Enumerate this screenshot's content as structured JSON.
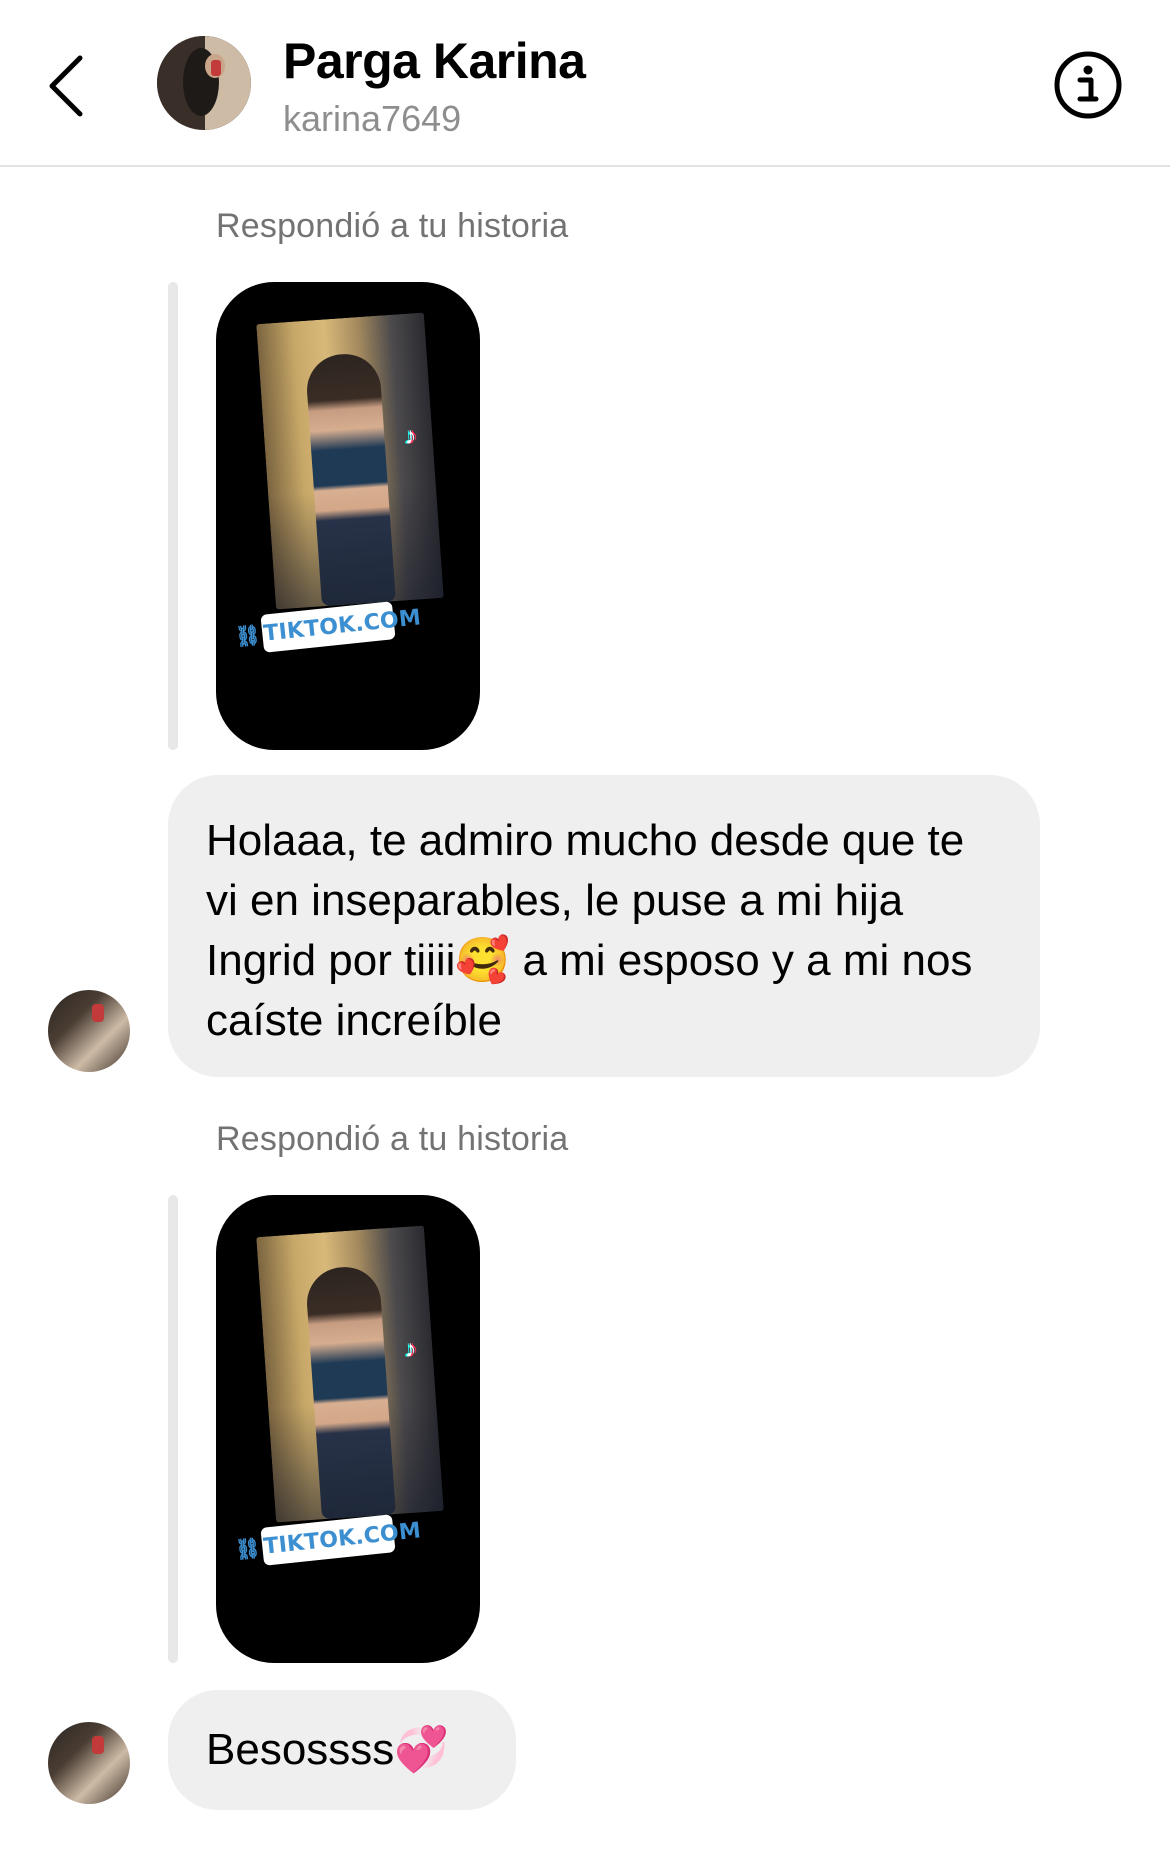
{
  "header": {
    "name": "Parga Karina",
    "username": "karina7649",
    "back_icon": "chevron-left-icon",
    "info_icon": "info-circle-icon"
  },
  "thread": [
    {
      "type": "story_reply",
      "caption": "Respondió a tu historia",
      "story_link_label": "TIKTOK.COM",
      "message": "Holaaa, te admiro mucho desde que te vi en inseparables, le puse a mi hija Ingrid por tiiii🥰 a mi esposo y a mi nos caíste increíble"
    },
    {
      "type": "story_reply",
      "caption": "Respondió a tu historia",
      "story_link_label": "TIKTOK.COM",
      "message": "Besossss💞"
    }
  ],
  "colors": {
    "bubble_bg": "#efefef",
    "caption_text": "#737373",
    "username_text": "#8e8e8e",
    "divider": "#e3e3e3",
    "link_text": "#3c8fd0"
  }
}
